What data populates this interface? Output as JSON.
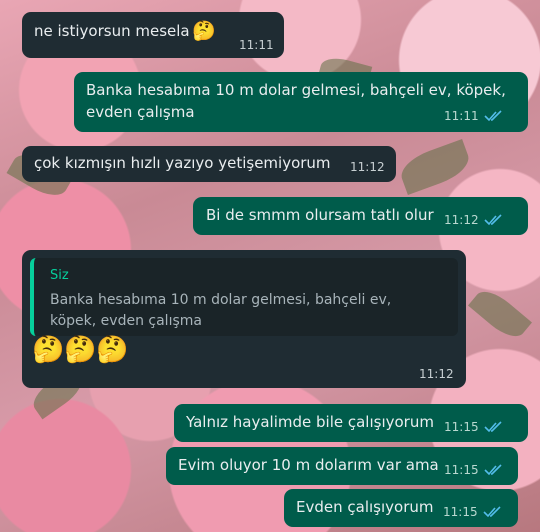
{
  "messages": [
    {
      "text": "ne istiyorsun mesela",
      "emoji": "🤔",
      "time": "11:11"
    },
    {
      "line1": "Banka hesabıma 10 m dolar gelmesi, bahçeli ev, köpek,",
      "line2": "evden çalışma",
      "time": "11:11"
    },
    {
      "text": "çok kızmışın hızlı yazıyo  yetişemiyorum",
      "time": "11:12"
    },
    {
      "text": "Bi de smmm olursam tatlı olur",
      "time": "11:12"
    },
    {
      "reply_author": "Siz",
      "reply_line1": "Banka hesabıma 10 m dolar gelmesi, bahçeli ev,",
      "reply_line2": "köpek, evden çalışma",
      "emojis": [
        "🤔",
        "🤔",
        "🤔"
      ],
      "time": "11:12"
    },
    {
      "text": "Yalnız hayalimde bile çalışıyorum",
      "time": "11:15"
    },
    {
      "text": "Evim oluyor 10 m dolarım var ama",
      "time": "11:15"
    },
    {
      "text": "Evden çalışıyorum",
      "time": "11:15"
    }
  ],
  "colors": {
    "incoming_bubble": "#1f2c33",
    "outgoing_bubble": "#005c4b",
    "read_tick": "#53bdeb",
    "reply_accent": "#06cf9c"
  },
  "icons": {
    "read_receipt": "double-check-icon"
  }
}
